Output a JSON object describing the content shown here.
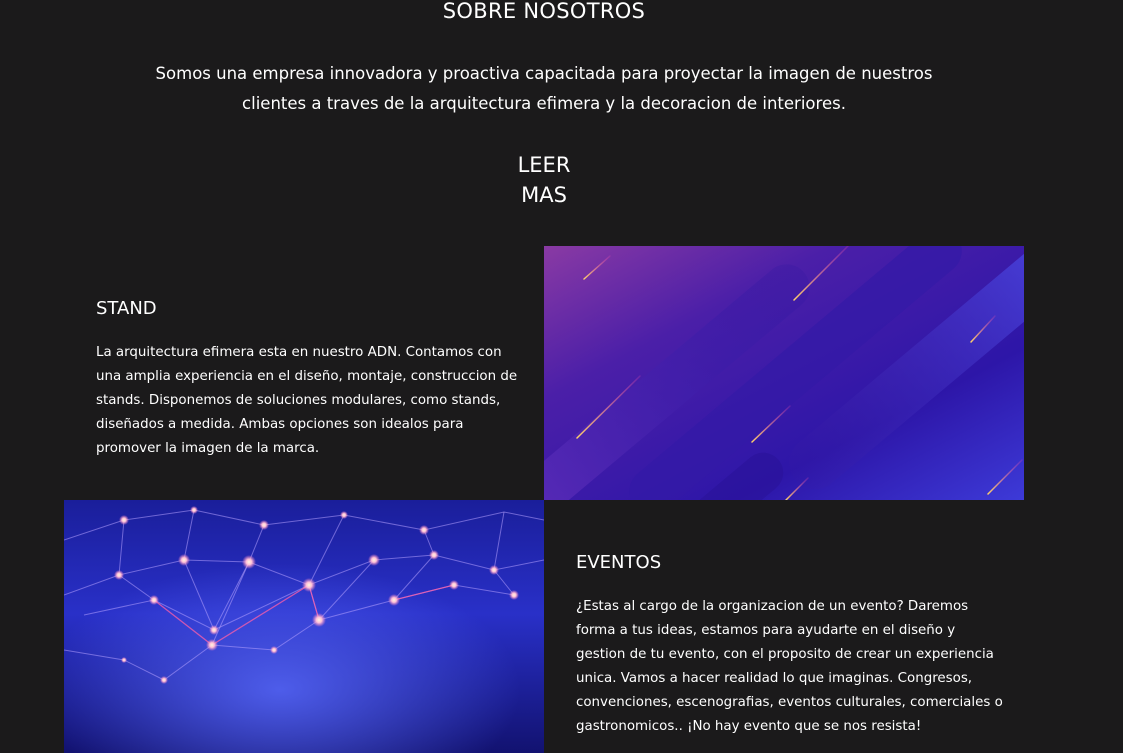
{
  "about": {
    "title": "SOBRE NOSOTROS",
    "description_line1": "Somos una empresa innovadora y proactiva capacitada para proyectar la imagen de nuestros",
    "description_line2": "clientes a traves de la arquitectura efimera y la decoracion de interiores.",
    "read_more": "LEER MAS"
  },
  "stand": {
    "heading": "STAND",
    "lines": [
      "La arquitectura efimera esta en nuestro ADN. Contamos con",
      "una amplia experiencia en el diseño, montaje, construccion de",
      "stands. Disponemos de soluciones modulares, como stands,",
      "diseñados a medida. Ambas opciones son idealos para",
      "promover la imagen de la marca."
    ]
  },
  "events": {
    "heading": "EVENTOS",
    "lines": [
      "¿Estas al cargo de la organizacion de un evento? Daremos",
      "forma a tus ideas, estamos para ayudarte en el diseño y",
      "gestion de tu evento, con el proposito de crear un experiencia",
      "unica. Vamos a hacer realidad lo que imaginas. Congresos,",
      "convenciones, escenografias, eventos culturales, comerciales o",
      "gastronomicos.. ¡No hay evento que se nos resista!"
    ]
  }
}
